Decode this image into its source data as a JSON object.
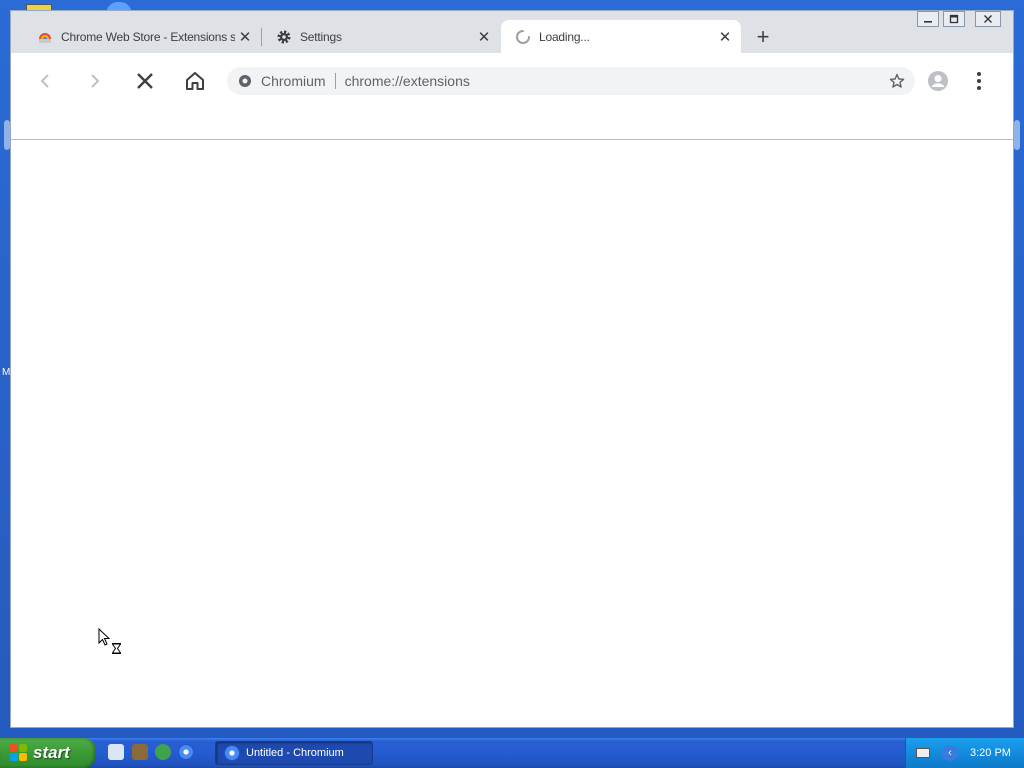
{
  "browser": {
    "tabs": [
      {
        "title": "Chrome Web Store - Extensions start",
        "icon": "chrome-web-store-icon",
        "active": false
      },
      {
        "title": "Settings",
        "icon": "gear-icon",
        "active": false
      },
      {
        "title": "Loading...",
        "icon": "loading-spinner-icon",
        "active": true
      }
    ],
    "new_tab_symbol": "+",
    "close_symbol": "✕",
    "omnibox": {
      "chip": "Chromium",
      "url": "chrome://extensions"
    }
  },
  "taskbar": {
    "start_label": "start",
    "task_label": "Untitled - Chromium",
    "clock": "3:20 PM"
  },
  "desktop": {
    "edge_letter": "M"
  },
  "colors": {
    "accent": "#1a73e8",
    "taskbar": "#245cd1",
    "start": "#3b9a36"
  }
}
